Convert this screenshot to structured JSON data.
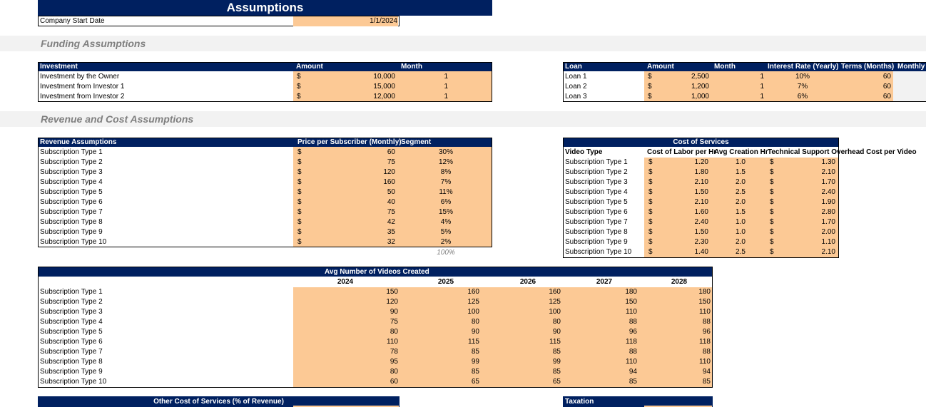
{
  "page": {
    "title": "Assumptions",
    "start_date_label": "Company Start Date",
    "start_date_value": "1/1/2024"
  },
  "sections": {
    "funding": "Funding Assumptions",
    "revenue_cost": "Revenue and Cost Assumptions"
  },
  "investment": {
    "headers": [
      "Investment",
      "Amount",
      "Month"
    ],
    "currency": "$",
    "rows": [
      {
        "label": "Investment by the Owner",
        "amount": "10,000",
        "month": "1"
      },
      {
        "label": "Investment from Investor 1",
        "amount": "15,000",
        "month": "1"
      },
      {
        "label": "Investment from Investor 2",
        "amount": "12,000",
        "month": "1"
      }
    ]
  },
  "loans": {
    "headers": [
      "Loan",
      "Amount",
      "Month",
      "Interest Rate (Yearly)",
      "Terms (Months)",
      "Monthly"
    ],
    "currency": "$",
    "rows": [
      {
        "label": "Loan 1",
        "amount": "2,500",
        "month": "1",
        "rate": "10%",
        "terms": "60"
      },
      {
        "label": "Loan 2",
        "amount": "1,200",
        "month": "1",
        "rate": "7%",
        "terms": "60"
      },
      {
        "label": "Loan 3",
        "amount": "1,000",
        "month": "1",
        "rate": "6%",
        "terms": "60"
      }
    ]
  },
  "revenue": {
    "headers": [
      "Revenue Assumptions",
      "Price per Subscriber (Monthly)",
      "Segment"
    ],
    "currency": "$",
    "rows": [
      {
        "label": "Subscription Type 1",
        "price": "60",
        "segment": "30%"
      },
      {
        "label": "Subscription Type 2",
        "price": "75",
        "segment": "12%"
      },
      {
        "label": "Subscription Type 3",
        "price": "120",
        "segment": "8%"
      },
      {
        "label": "Subscription Type 4",
        "price": "160",
        "segment": "7%"
      },
      {
        "label": "Subscription Type 5",
        "price": "50",
        "segment": "11%"
      },
      {
        "label": "Subscription Type 6",
        "price": "40",
        "segment": "6%"
      },
      {
        "label": "Subscription Type 7",
        "price": "75",
        "segment": "15%"
      },
      {
        "label": "Subscription Type 8",
        "price": "42",
        "segment": "4%"
      },
      {
        "label": "Subscription Type 9",
        "price": "35",
        "segment": "5%"
      },
      {
        "label": "Subscription Type 10",
        "price": "32",
        "segment": "2%"
      }
    ],
    "segment_total": "100%"
  },
  "cost_of_services": {
    "title": "Cost of Services",
    "headers": [
      "Video Type",
      "Cost of Labor per Hr",
      "Avg Creation Hr",
      "Technical Support Overhead Cost per Video"
    ],
    "currency": "$",
    "rows": [
      {
        "label": "Subscription Type 1",
        "labor": "1.20",
        "hours": "1.0",
        "overhead": "1.30"
      },
      {
        "label": "Subscription Type 2",
        "labor": "1.80",
        "hours": "1.5",
        "overhead": "2.10"
      },
      {
        "label": "Subscription Type 3",
        "labor": "2.10",
        "hours": "2.0",
        "overhead": "1.70"
      },
      {
        "label": "Subscription Type 4",
        "labor": "1.50",
        "hours": "2.5",
        "overhead": "2.40"
      },
      {
        "label": "Subscription Type 5",
        "labor": "2.10",
        "hours": "2.0",
        "overhead": "1.90"
      },
      {
        "label": "Subscription Type 6",
        "labor": "1.60",
        "hours": "1.5",
        "overhead": "2.80"
      },
      {
        "label": "Subscription Type 7",
        "labor": "2.40",
        "hours": "1.0",
        "overhead": "1.70"
      },
      {
        "label": "Subscription Type 8",
        "labor": "1.50",
        "hours": "1.0",
        "overhead": "2.00"
      },
      {
        "label": "Subscription Type 9",
        "labor": "2.30",
        "hours": "2.0",
        "overhead": "1.10"
      },
      {
        "label": "Subscription Type 10",
        "labor": "1.40",
        "hours": "2.5",
        "overhead": "2.10"
      }
    ]
  },
  "videos": {
    "title": "Avg Number of Videos Created",
    "years": [
      "2024",
      "2025",
      "2026",
      "2027",
      "2028"
    ],
    "rows": [
      {
        "label": "Subscription Type 1",
        "values": [
          "150",
          "160",
          "160",
          "180",
          "180"
        ]
      },
      {
        "label": "Subscription Type 2",
        "values": [
          "120",
          "125",
          "125",
          "150",
          "150"
        ]
      },
      {
        "label": "Subscription Type 3",
        "values": [
          "90",
          "100",
          "100",
          "110",
          "110"
        ]
      },
      {
        "label": "Subscription Type 4",
        "values": [
          "75",
          "80",
          "80",
          "88",
          "88"
        ]
      },
      {
        "label": "Subscription Type 5",
        "values": [
          "80",
          "90",
          "90",
          "96",
          "96"
        ]
      },
      {
        "label": "Subscription Type 6",
        "values": [
          "110",
          "115",
          "115",
          "118",
          "118"
        ]
      },
      {
        "label": "Subscription Type 7",
        "values": [
          "78",
          "85",
          "85",
          "88",
          "88"
        ]
      },
      {
        "label": "Subscription Type 8",
        "values": [
          "95",
          "99",
          "99",
          "110",
          "110"
        ]
      },
      {
        "label": "Subscription Type 9",
        "values": [
          "80",
          "85",
          "85",
          "94",
          "94"
        ]
      },
      {
        "label": "Subscription Type 10",
        "values": [
          "60",
          "65",
          "65",
          "85",
          "85"
        ]
      }
    ]
  },
  "other_cost": {
    "title": "Other Cost of Services (% of Revenue)"
  },
  "taxation": {
    "title": "Taxation"
  },
  "colors": {
    "header": "#002060",
    "input": "#fcc995",
    "band": "#f2f2f2",
    "band_text": "#7f7f7f"
  }
}
